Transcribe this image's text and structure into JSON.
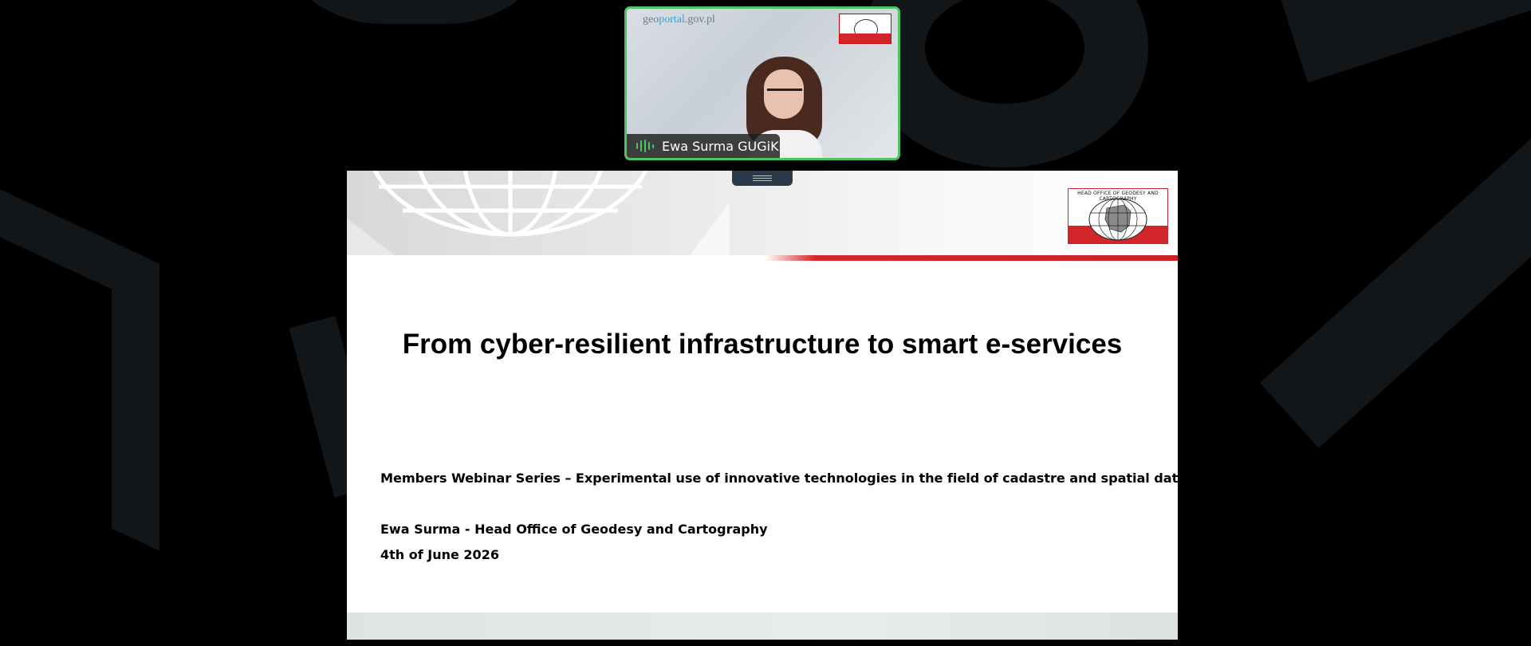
{
  "participant": {
    "name": "Ewa Surma GUGiK",
    "video_site_prefix": "geo",
    "video_site_accent": "portal",
    "video_site_suffix": ".gov.pl"
  },
  "slide": {
    "logo_caption": "HEAD OFFICE OF GEODESY AND CARTOGRAPHY",
    "title": "From cyber-resilient infrastructure to smart e-services",
    "series_line": "Members Webinar Series – Experimental use of innovative technologies in the field of cadastre and spatial data",
    "author_line": "Ewa Surma - Head Office of Geodesy and Cartography",
    "date_line": "4th of June 2026"
  },
  "colors": {
    "speaking_border": "#4fc463",
    "brand_red": "#d3262a",
    "background": "#000000"
  }
}
